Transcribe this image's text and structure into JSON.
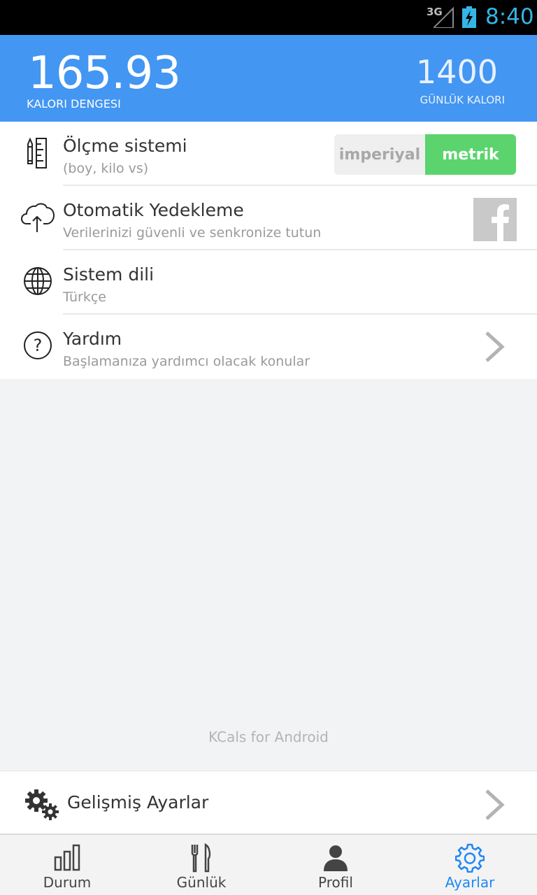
{
  "status_bar": {
    "network": "3G",
    "time": "8:40"
  },
  "header": {
    "balance_value": "165.93",
    "balance_label": "KALORI DENGESI",
    "daily_value": "1400",
    "daily_label": "GÜNLÜK KALORI"
  },
  "settings": {
    "measurement": {
      "title": "Ölçme sistemi",
      "subtitle": "(boy, kilo vs)",
      "option_imperial": "imperiyal",
      "option_metric": "metrik",
      "selected": "metrik"
    },
    "backup": {
      "title": "Otomatik Yedekleme",
      "subtitle": "Verilerinizi güvenli ve senkronize tutun"
    },
    "language": {
      "title": "Sistem dili",
      "subtitle": "Türkçe"
    },
    "help": {
      "title": "Yardım",
      "subtitle": "Başlamanıza yardımcı olacak konular"
    }
  },
  "footer_text": "KCals for Android",
  "advanced": {
    "title": "Gelişmiş Ayarlar"
  },
  "nav": {
    "tabs": [
      {
        "label": "Durum",
        "icon": "bar-chart-icon"
      },
      {
        "label": "Günlük",
        "icon": "fork-knife-icon"
      },
      {
        "label": "Profil",
        "icon": "person-icon"
      },
      {
        "label": "Ayarlar",
        "icon": "gear-icon"
      }
    ],
    "active": "Ayarlar"
  },
  "colors": {
    "header": "#4396f2",
    "toggle_on": "#5bd46e",
    "nav_active": "#1f86f5",
    "status_time": "#35b5e5"
  }
}
